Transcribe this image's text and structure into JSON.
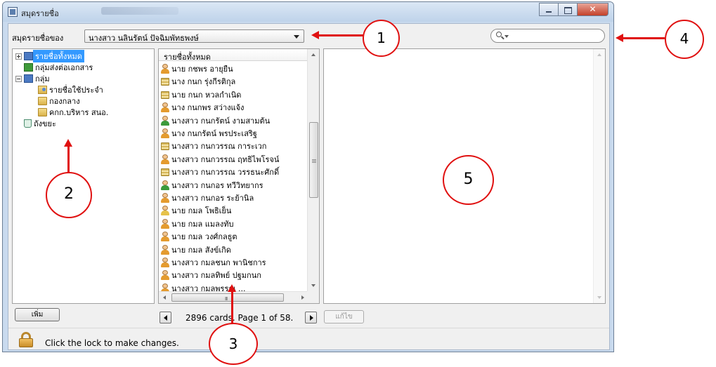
{
  "window": {
    "title": "สมุดรายชื่อ",
    "controls": {
      "minimize": "minimize",
      "maximize": "maximize",
      "close": "✕"
    }
  },
  "owner": {
    "label": "สมุดรายชื่อของ",
    "selected": "นางสาว นลินรัตน์ ปัจฉิมพัทธพงษ์"
  },
  "search": {
    "placeholder": ""
  },
  "groups_tree": [
    {
      "label": "รายชื่อทั้งหมด",
      "icon": "address-book-icon",
      "expander": "plus",
      "level": 0,
      "selected": true
    },
    {
      "label": "กลุ่มส่งต่อเอกสาร",
      "icon": "distribution-group-icon",
      "expander": "",
      "level": 1,
      "selected": false
    },
    {
      "label": "กลุ่ม",
      "icon": "group-book-icon",
      "expander": "minus",
      "level": 0,
      "selected": false
    },
    {
      "label": "รายชื่อใช้ประจำ",
      "icon": "favorites-folder-icon",
      "expander": "",
      "level": 2,
      "selected": false
    },
    {
      "label": "กองกลาง",
      "icon": "folder-icon",
      "expander": "",
      "level": 2,
      "selected": false
    },
    {
      "label": "คกก.บริหาร สนอ.",
      "icon": "folder-icon",
      "expander": "",
      "level": 2,
      "selected": false
    },
    {
      "label": "ถังขยะ",
      "icon": "trash-icon",
      "expander": "",
      "level": 0,
      "selected": false
    }
  ],
  "cards": {
    "header": "รายชื่อทั้งหมด",
    "items": [
      {
        "name": "นาย กชพร อายุยืน",
        "icon": "orange"
      },
      {
        "name": "นาง กนก รุ่งกีรติกุล",
        "icon": "stack"
      },
      {
        "name": "นาย กนก หวลกำเนิด",
        "icon": "stack"
      },
      {
        "name": "นาง กนกพร สว่างแจ้ง",
        "icon": "orange"
      },
      {
        "name": "นางสาว กนกรัตน์ งามสามต้น",
        "icon": "green"
      },
      {
        "name": "นาง กนกรัตน์ พรประเสริฐ",
        "icon": "orange"
      },
      {
        "name": "นางสาว กนกวรรณ การะเวก",
        "icon": "stack"
      },
      {
        "name": "นางสาว กนกวรรณ ฤทธิไพโรจน์",
        "icon": "orange"
      },
      {
        "name": "นางสาว กนกวรรณ วรรธนะศักดิ์",
        "icon": "stack"
      },
      {
        "name": "นางสาว กนกอร ทวีวิทยากร",
        "icon": "green"
      },
      {
        "name": "นางสาว กนกอร ระย้านิล",
        "icon": "orange"
      },
      {
        "name": "นาย กมล โพธิเย็น",
        "icon": "yellow"
      },
      {
        "name": "นาย กมล แมลงทับ",
        "icon": "orange"
      },
      {
        "name": "นาย กมล วงศ์กลธูต",
        "icon": "orange"
      },
      {
        "name": "นาย กมล สังข์เกิด",
        "icon": "orange"
      },
      {
        "name": "นางสาว กมลชนก พานิชการ",
        "icon": "orange"
      },
      {
        "name": "นางสาว กมลทิพย์ ปฐมกนก",
        "icon": "orange"
      },
      {
        "name": "นางสาว กมลพรรณ ...",
        "icon": "orange"
      }
    ]
  },
  "toolbar": {
    "add_label": "เพิ่ม",
    "status": "2896 cards. Page 1 of 58.",
    "edit_label": "แก้ไข"
  },
  "lock": {
    "text": "Click the lock to make changes."
  },
  "annotations": [
    "1",
    "2",
    "3",
    "4",
    "5"
  ],
  "colors": {
    "annotation": "#e01010",
    "selection": "#3399ff"
  }
}
